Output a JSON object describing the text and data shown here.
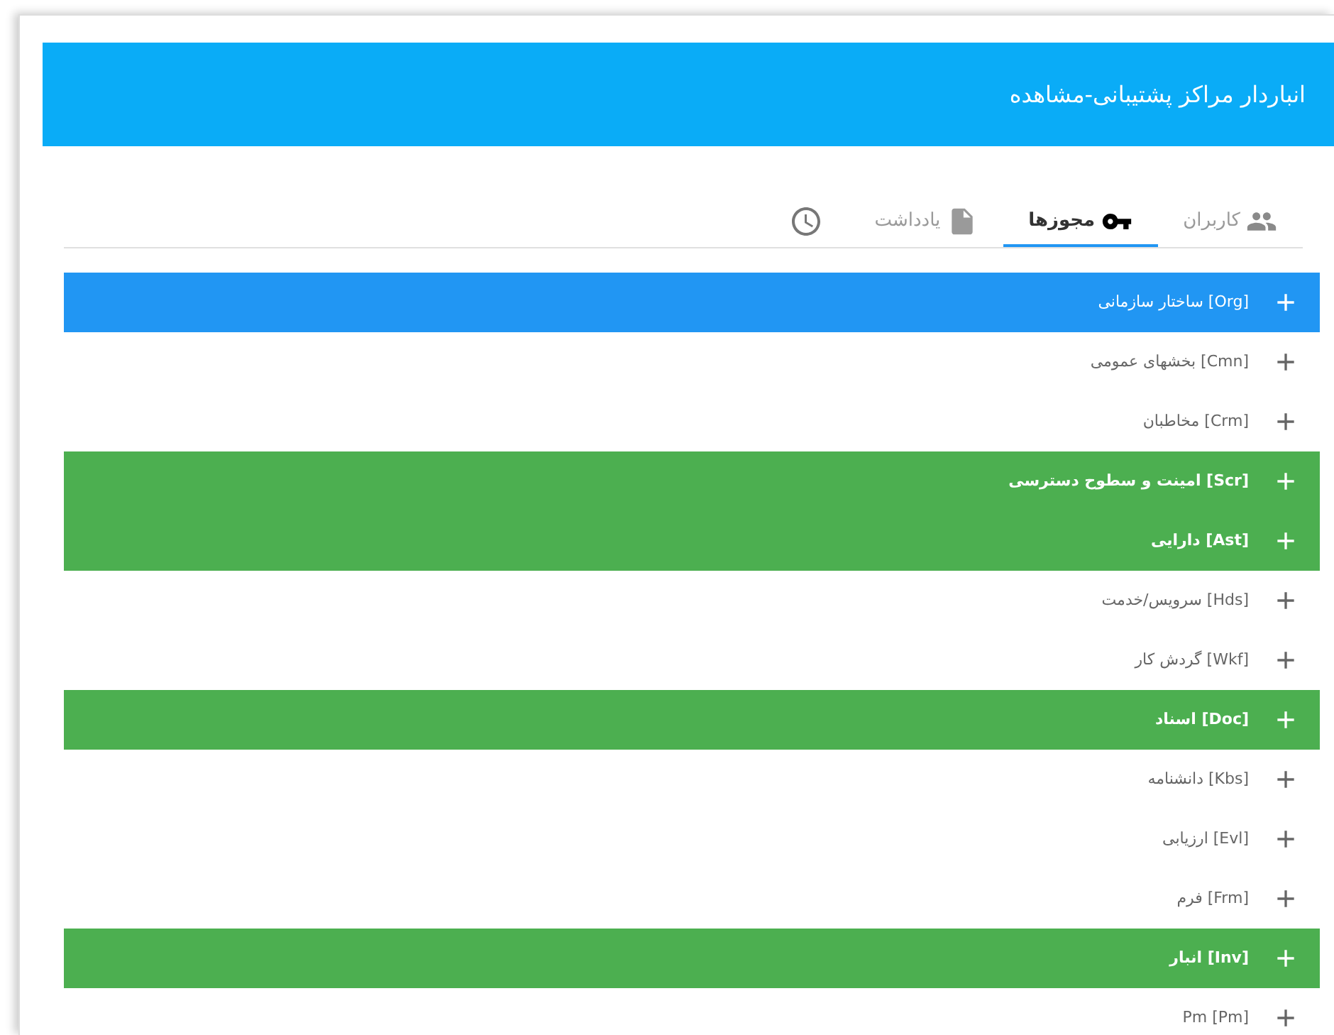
{
  "header": {
    "title": "انباردار مراکز پشتیبانی-مشاهده"
  },
  "tabs": [
    {
      "kind": "users",
      "label": "کاربران",
      "selected": false
    },
    {
      "kind": "permissions",
      "label": "مجوزها",
      "selected": true
    },
    {
      "kind": "notes",
      "label": "یادداشت",
      "selected": false
    },
    {
      "kind": "history",
      "selected": false
    }
  ],
  "rows": [
    {
      "label": "[Org] ساختار سازمانی",
      "selected": true,
      "granted": false
    },
    {
      "label": "[Cmn] بخشهای عمومی",
      "selected": false,
      "granted": false
    },
    {
      "label": "[Crm] مخاطبان",
      "selected": false,
      "granted": false
    },
    {
      "label": "[Scr] امینت و سطوح دسترسی",
      "selected": false,
      "granted": true
    },
    {
      "label": "[Ast] دارایی",
      "selected": false,
      "granted": true
    },
    {
      "label": "[Hds] سرویس/خدمت",
      "selected": false,
      "granted": false
    },
    {
      "label": "[Wkf] گردش کار",
      "selected": false,
      "granted": false
    },
    {
      "label": "[Doc] اسناد",
      "selected": false,
      "granted": true
    },
    {
      "label": "[Kbs] دانشنامه",
      "selected": false,
      "granted": false
    },
    {
      "label": "[Evl] ارزیابی",
      "selected": false,
      "granted": false
    },
    {
      "label": "[Frm] فرم",
      "selected": false,
      "granted": false
    },
    {
      "label": "[Inv] انبار",
      "selected": false,
      "granted": true
    },
    {
      "label": "Pm [Pm]",
      "selected": false,
      "granted": false
    }
  ]
}
